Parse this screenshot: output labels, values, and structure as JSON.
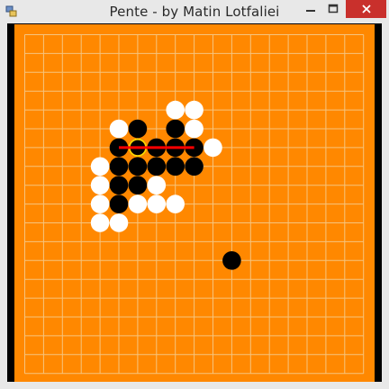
{
  "window": {
    "title": "Pente - by Matin Lotfaliei",
    "controls": {
      "minimize": "minimize",
      "maximize": "maximize",
      "close": "close"
    }
  },
  "board": {
    "size": 19,
    "background_color": "#ff8800",
    "line_color": "#f6c47e",
    "black_stones": [
      [
        6,
        5
      ],
      [
        8,
        5
      ],
      [
        5,
        6
      ],
      [
        6,
        6
      ],
      [
        7,
        6
      ],
      [
        8,
        6
      ],
      [
        9,
        6
      ],
      [
        5,
        7
      ],
      [
        6,
        7
      ],
      [
        7,
        7
      ],
      [
        8,
        7
      ],
      [
        9,
        7
      ],
      [
        5,
        8
      ],
      [
        6,
        8
      ],
      [
        5,
        9
      ],
      [
        11,
        12
      ]
    ],
    "white_stones": [
      [
        8,
        4
      ],
      [
        9,
        4
      ],
      [
        5,
        5
      ],
      [
        9,
        5
      ],
      [
        10,
        6
      ],
      [
        4,
        7
      ],
      [
        9,
        7
      ],
      [
        4,
        8
      ],
      [
        7,
        8
      ],
      [
        4,
        9
      ],
      [
        6,
        9
      ],
      [
        7,
        9
      ],
      [
        8,
        9
      ],
      [
        4,
        10
      ],
      [
        5,
        10
      ]
    ],
    "highlighted_stone": [
      6,
      6
    ],
    "highlight_color": "#ffd400",
    "win_line": {
      "from": [
        5,
        6
      ],
      "to": [
        9,
        6
      ],
      "color": "#ff0000"
    }
  }
}
